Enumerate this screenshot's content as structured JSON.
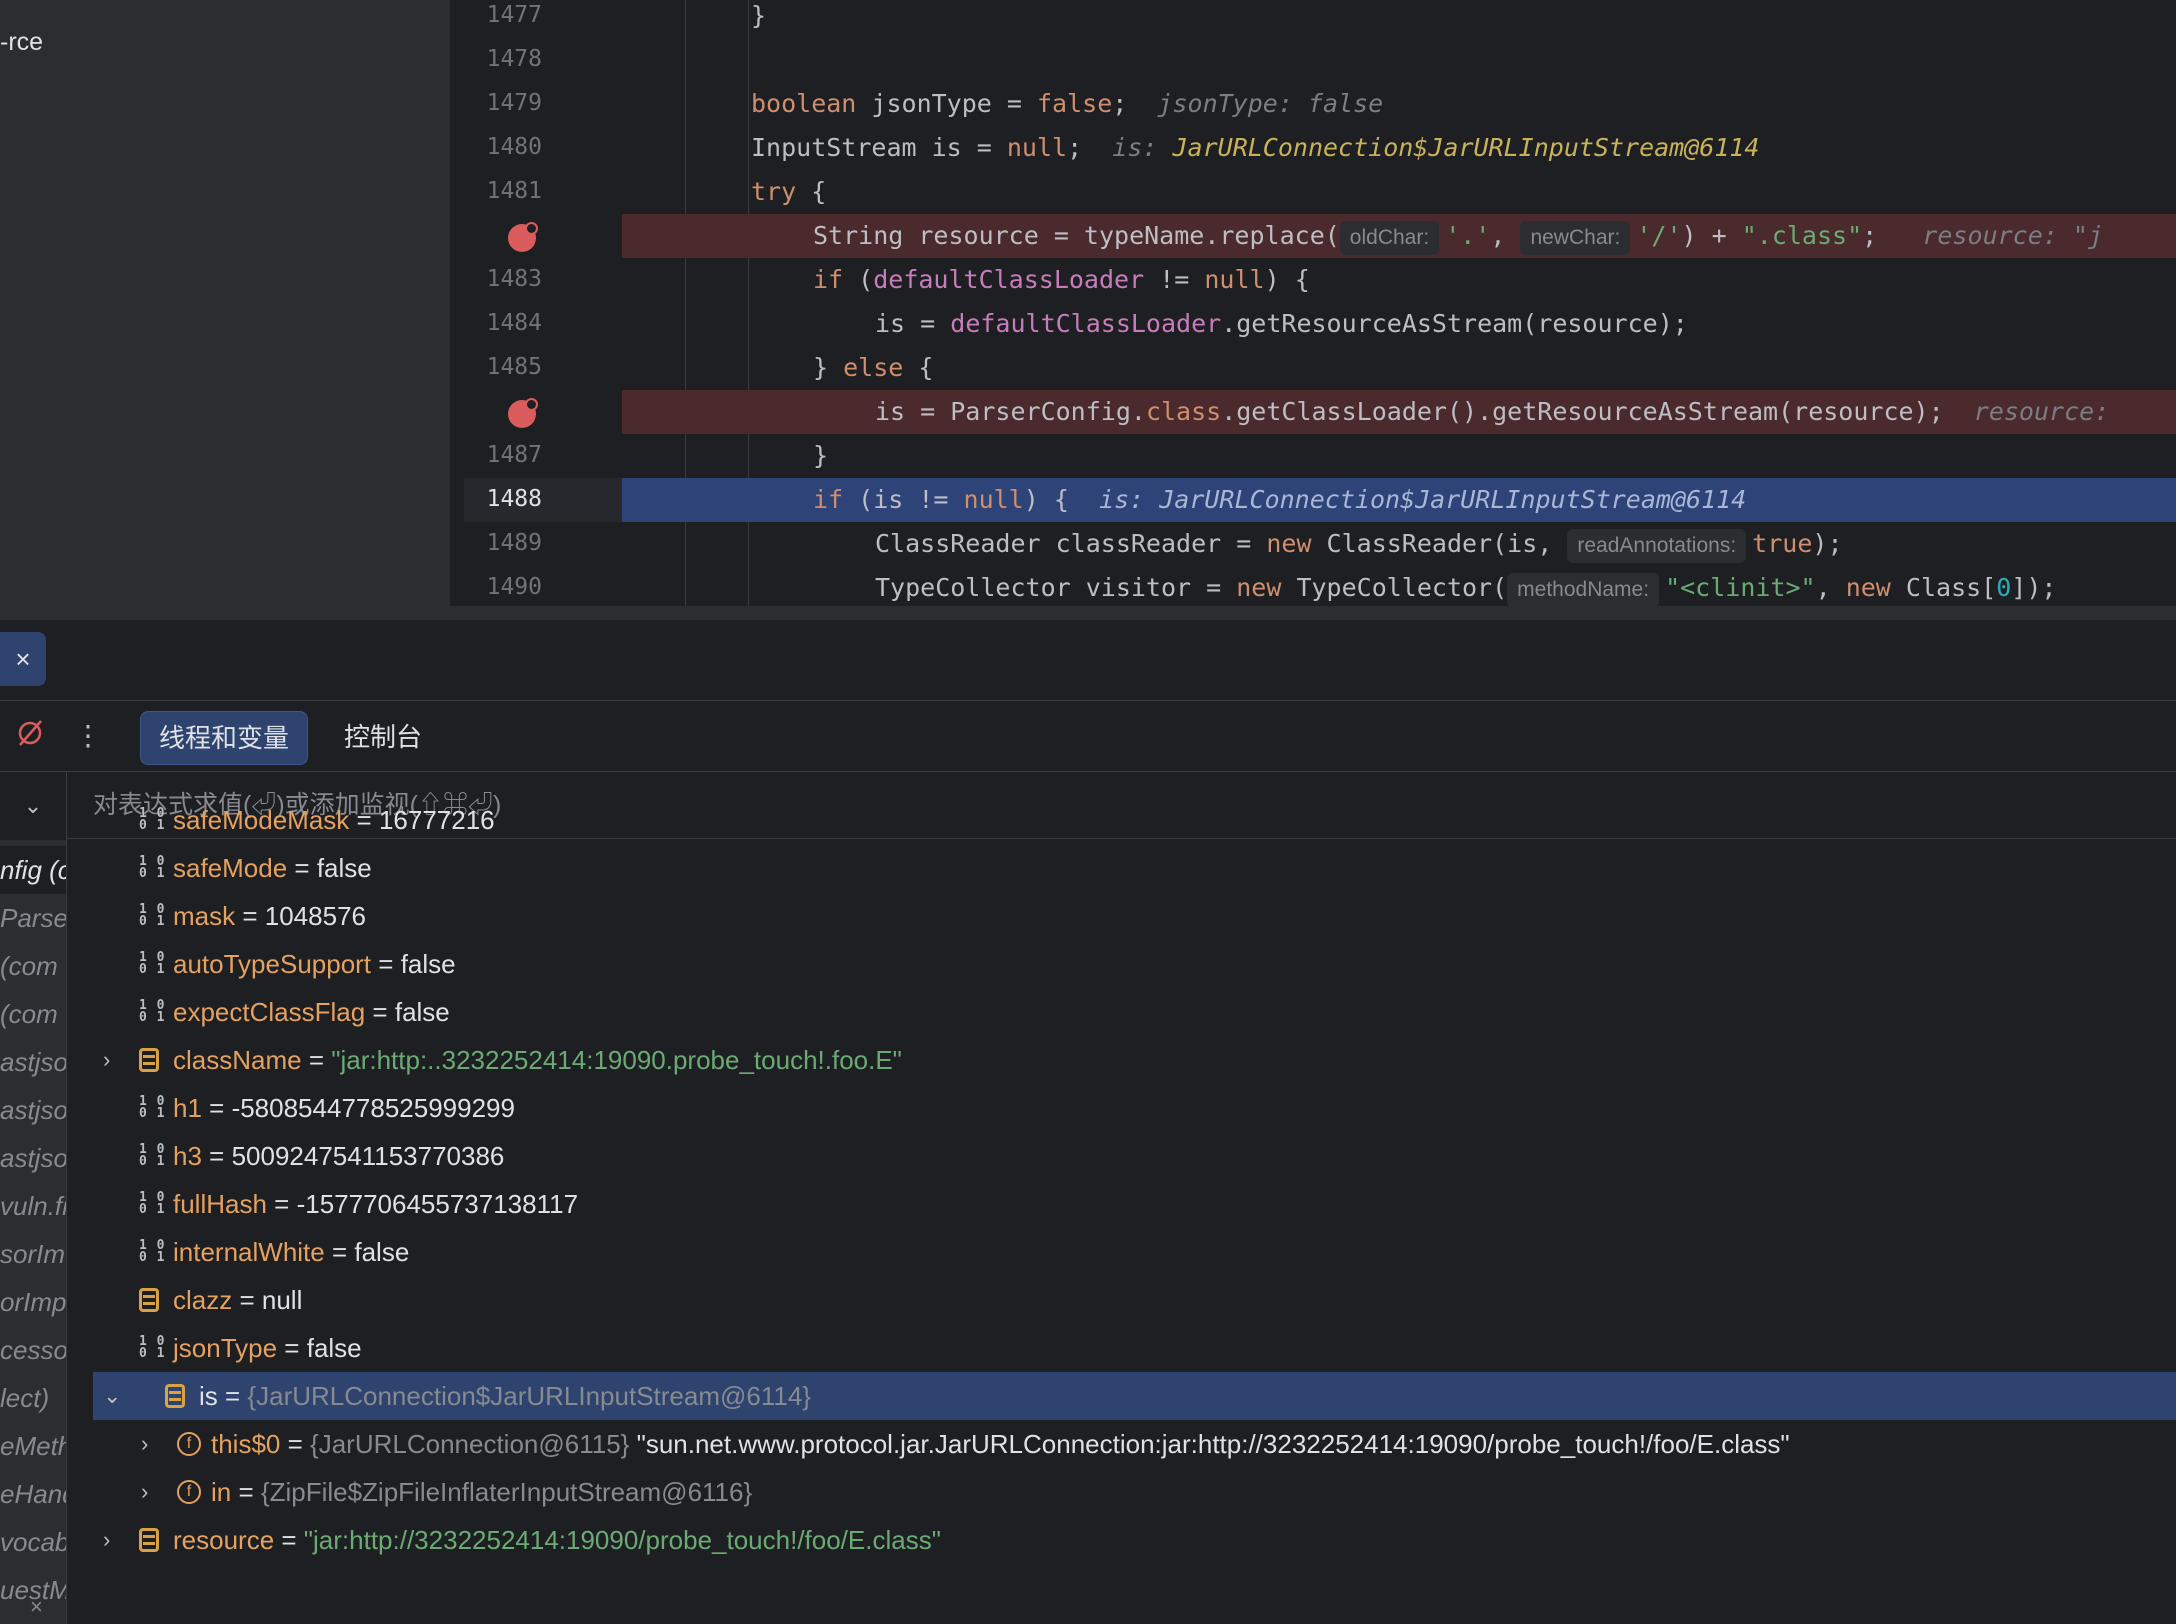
{
  "project": {
    "label": "-rce"
  },
  "editor": {
    "lines": [
      {
        "no": "1477"
      },
      {
        "no": "1478"
      },
      {
        "no": "1479"
      },
      {
        "no": "1480"
      },
      {
        "no": "1481"
      },
      {
        "no": ""
      },
      {
        "no": "1483"
      },
      {
        "no": "1484"
      },
      {
        "no": "1485"
      },
      {
        "no": ""
      },
      {
        "no": "1487"
      },
      {
        "no": "1488"
      },
      {
        "no": "1489"
      },
      {
        "no": "1490"
      }
    ],
    "code": {
      "l1477": "}",
      "l1479_kw": "boolean",
      "l1479_rest": " jsonType = ",
      "l1479_false": "false",
      "l1479_end": ";",
      "l1479_hint": "jsonType: false",
      "l1480_a": "InputStream is = ",
      "l1480_null": "null",
      "l1480_end": ";",
      "l1480_hint_label": "is: ",
      "l1480_hint_obj": "JarURLConnection$JarURLInputStream@6114",
      "l1481_kw": "try",
      "l1481_rest": " {",
      "l1482_a": "String resource = typeName.replace(",
      "l1482_h1": "oldChar:",
      "l1482_s1": "'.'",
      "l1482_comma": ", ",
      "l1482_h2": "newChar:",
      "l1482_s2": "'/'",
      "l1482_plus": ") + ",
      "l1482_s3": "\".class\"",
      "l1482_end": ";",
      "l1482_hint": "resource: \"j",
      "l1483_kw": "if",
      "l1483_a": " (",
      "l1483_fld": "defaultClassLoader",
      "l1483_b": " != ",
      "l1483_null": "null",
      "l1483_c": ") {",
      "l1484_a": "is = ",
      "l1484_fld": "defaultClassLoader",
      "l1484_b": ".getResourceAsStream(resource);",
      "l1485_a": "} ",
      "l1485_kw": "else",
      "l1485_b": " {",
      "l1486_a": "is = ParserConfig.",
      "l1486_kw": "class",
      "l1486_b": ".getClassLoader().getResourceAsStream(resource);",
      "l1486_hint": "resource:",
      "l1487": "}",
      "l1488_kw": "if",
      "l1488_a": " (is != ",
      "l1488_null": "null",
      "l1488_b": ") {",
      "l1488_hint": "is: JarURLConnection$JarURLInputStream@6114",
      "l1489_a": "ClassReader classReader = ",
      "l1489_kw": "new",
      "l1489_b": " ClassReader(is, ",
      "l1489_h": "readAnnotations:",
      "l1489_true": "true",
      "l1489_end": ");",
      "l1490_a": "TypeCollector visitor = ",
      "l1490_kw": "new",
      "l1490_b": " TypeCollector(",
      "l1490_h": "methodName:",
      "l1490_s": "\"<clinit>\"",
      "l1490_c": ", ",
      "l1490_kw2": "new",
      "l1490_d": " Class[",
      "l1490_n": "0",
      "l1490_e": "]);"
    }
  },
  "toolbar": {
    "close_label": "×",
    "more_label": "⋮",
    "tabs": [
      {
        "label": "线程和变量"
      },
      {
        "label": "控制台"
      }
    ]
  },
  "frames": {
    "collapse_label": "⌄",
    "items": [
      "nfig (c",
      "Parser",
      " (com",
      " (com",
      "astjso",
      "astjso",
      "astjso",
      "vuln.fi",
      "sorIm",
      "orImpl",
      "cessor",
      "lect)",
      "eMeth",
      "eHand",
      "vocab",
      "uestM"
    ],
    "close_label": "×"
  },
  "evaluate": {
    "placeholder": "对表达式求值(⏎)或添加监视(⇧⌘⏎)"
  },
  "variables": [
    {
      "name": "safeModeMask",
      "eq": " = ",
      "value": "16777216",
      "icon": "num"
    },
    {
      "name": "safeMode",
      "eq": " = ",
      "value": "false",
      "icon": "num"
    },
    {
      "name": "mask",
      "eq": " = ",
      "value": "1048576",
      "icon": "num"
    },
    {
      "name": "autoTypeSupport",
      "eq": " = ",
      "value": "false",
      "icon": "num"
    },
    {
      "name": "expectClassFlag",
      "eq": " = ",
      "value": "false",
      "icon": "num"
    },
    {
      "name": "className",
      "eq": " = ",
      "value": "\"jar:http:..3232252414:19090.probe_touch!.foo.E\"",
      "icon": "obj",
      "expand": "›"
    },
    {
      "name": "h1",
      "eq": " = ",
      "value": "-5808544778525999299",
      "icon": "num"
    },
    {
      "name": "h3",
      "eq": " = ",
      "value": "5009247541153770386",
      "icon": "num"
    },
    {
      "name": "fullHash",
      "eq": " = ",
      "value": "-1577706455737138117",
      "icon": "num"
    },
    {
      "name": "internalWhite",
      "eq": " = ",
      "value": "false",
      "icon": "num"
    },
    {
      "name": "clazz",
      "eq": " = ",
      "value": "null",
      "icon": "obj"
    },
    {
      "name": "jsonType",
      "eq": " = ",
      "value": "false",
      "icon": "num"
    },
    {
      "name": "is",
      "eq": " = ",
      "ref": "{JarURLConnection$JarURLInputStream@6114}",
      "icon": "obj",
      "expand": "⌄",
      "selected": true
    },
    {
      "name": "this$0",
      "eq": " = ",
      "ref": "{JarURLConnection@6115}",
      "value": " \"sun.net.www.protocol.jar.JarURLConnection:jar:http://3232252414:19090/probe_touch!/foo/E.class\"",
      "icon": "circle",
      "expand": "›",
      "child": true
    },
    {
      "name": "in",
      "eq": " = ",
      "ref": "{ZipFile$ZipFileInflaterInputStream@6116}",
      "icon": "circle",
      "expand": "›",
      "child": true
    },
    {
      "name": "resource",
      "eq": " = ",
      "value": "\"jar:http://3232252414:19090/probe_touch!/foo/E.class\"",
      "icon": "obj",
      "expand": "›"
    }
  ],
  "colors": {
    "accent": "#2e436e",
    "selected_line": "#2e4377",
    "breakpoint": "#db5c5c",
    "string": "#6aab73",
    "keyword": "#cf8e6d",
    "field_name": "#e5a160"
  }
}
